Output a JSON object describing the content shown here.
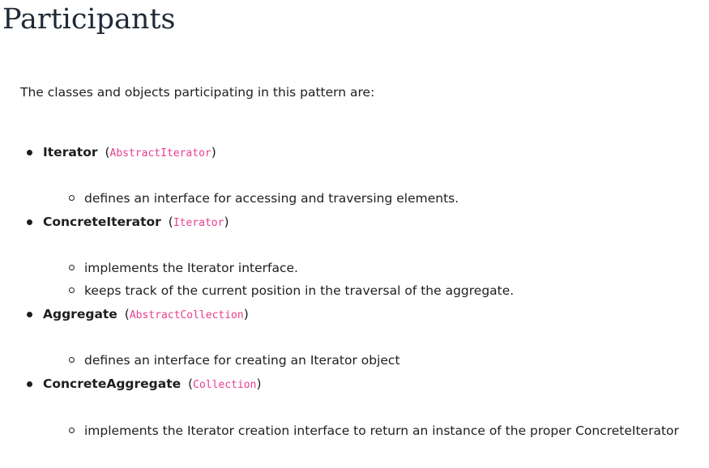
{
  "page": {
    "title": "Participants",
    "intro": "The classes and objects participating in this pattern are:"
  },
  "participants": [
    {
      "name": "Iterator",
      "code": "AbstractIterator",
      "details": [
        "defines an interface for accessing and traversing elements."
      ]
    },
    {
      "name": "ConcreteIterator",
      "code": "Iterator",
      "details": [
        "implements the Iterator interface.",
        "keeps track of the current position in the traversal of the aggregate."
      ]
    },
    {
      "name": "Aggregate",
      "code": "AbstractCollection",
      "details": [
        "defines an interface for creating an Iterator object"
      ]
    },
    {
      "name": "ConcreteAggregate",
      "code": "Collection",
      "details": [
        "implements the Iterator creation interface to return an instance of the proper ConcreteIterator"
      ]
    }
  ],
  "symbols": {
    "open_paren": "(",
    "close_paren": ")"
  },
  "colors": {
    "text": "#1e1e1e",
    "heading": "#1f2a36",
    "code": "#e83e8c"
  }
}
